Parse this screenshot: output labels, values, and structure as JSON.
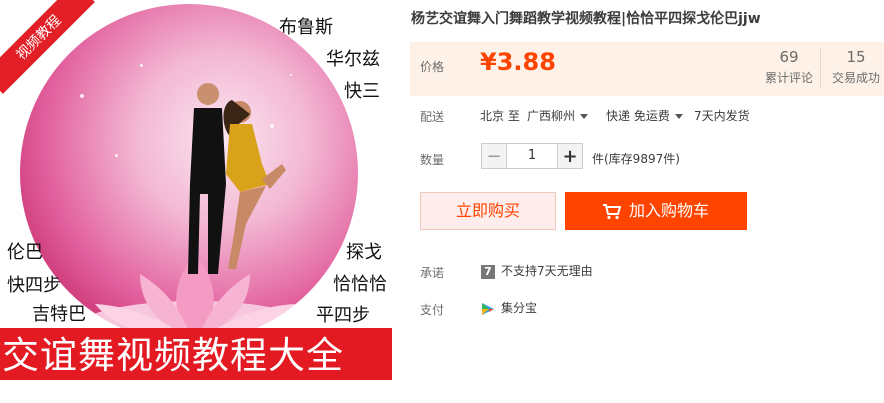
{
  "image": {
    "corner_tag": "视频教程",
    "labels_top_right": [
      "布鲁斯",
      "华尔兹",
      "快三"
    ],
    "labels_left": [
      "伦巴",
      "快四步",
      "吉特巴"
    ],
    "labels_right": [
      "探戈",
      "恰恰恰",
      "平四步"
    ],
    "banner": "交谊舞视频教程大全"
  },
  "product": {
    "title": "杨艺交谊舞入门舞蹈教学视频教程|恰恰平四探戈伦巴jjw",
    "price_label": "价格",
    "price": "¥3.88",
    "reviews_count": "69",
    "reviews_label": "累计评论",
    "trades_count": "15",
    "trades_label": "交易成功"
  },
  "shipping": {
    "label": "配送",
    "from": "北京 至",
    "to": "广西柳州",
    "method": "快递 免运费",
    "dispatch": "7天内发货"
  },
  "quantity": {
    "label": "数量",
    "minus": "−",
    "value": "1",
    "plus": "+",
    "stock": "件(库存9897件)"
  },
  "actions": {
    "buy_now": "立即购买",
    "add_to_cart": "加入购物车"
  },
  "promise": {
    "label": "承诺",
    "icon_text": "7",
    "text": "不支持7天无理由"
  },
  "payment": {
    "label": "支付",
    "text": "集分宝"
  },
  "colors": {
    "accent": "#ff4400",
    "banner_red": "#e41a22",
    "price_bg": "#fdf1e8"
  }
}
